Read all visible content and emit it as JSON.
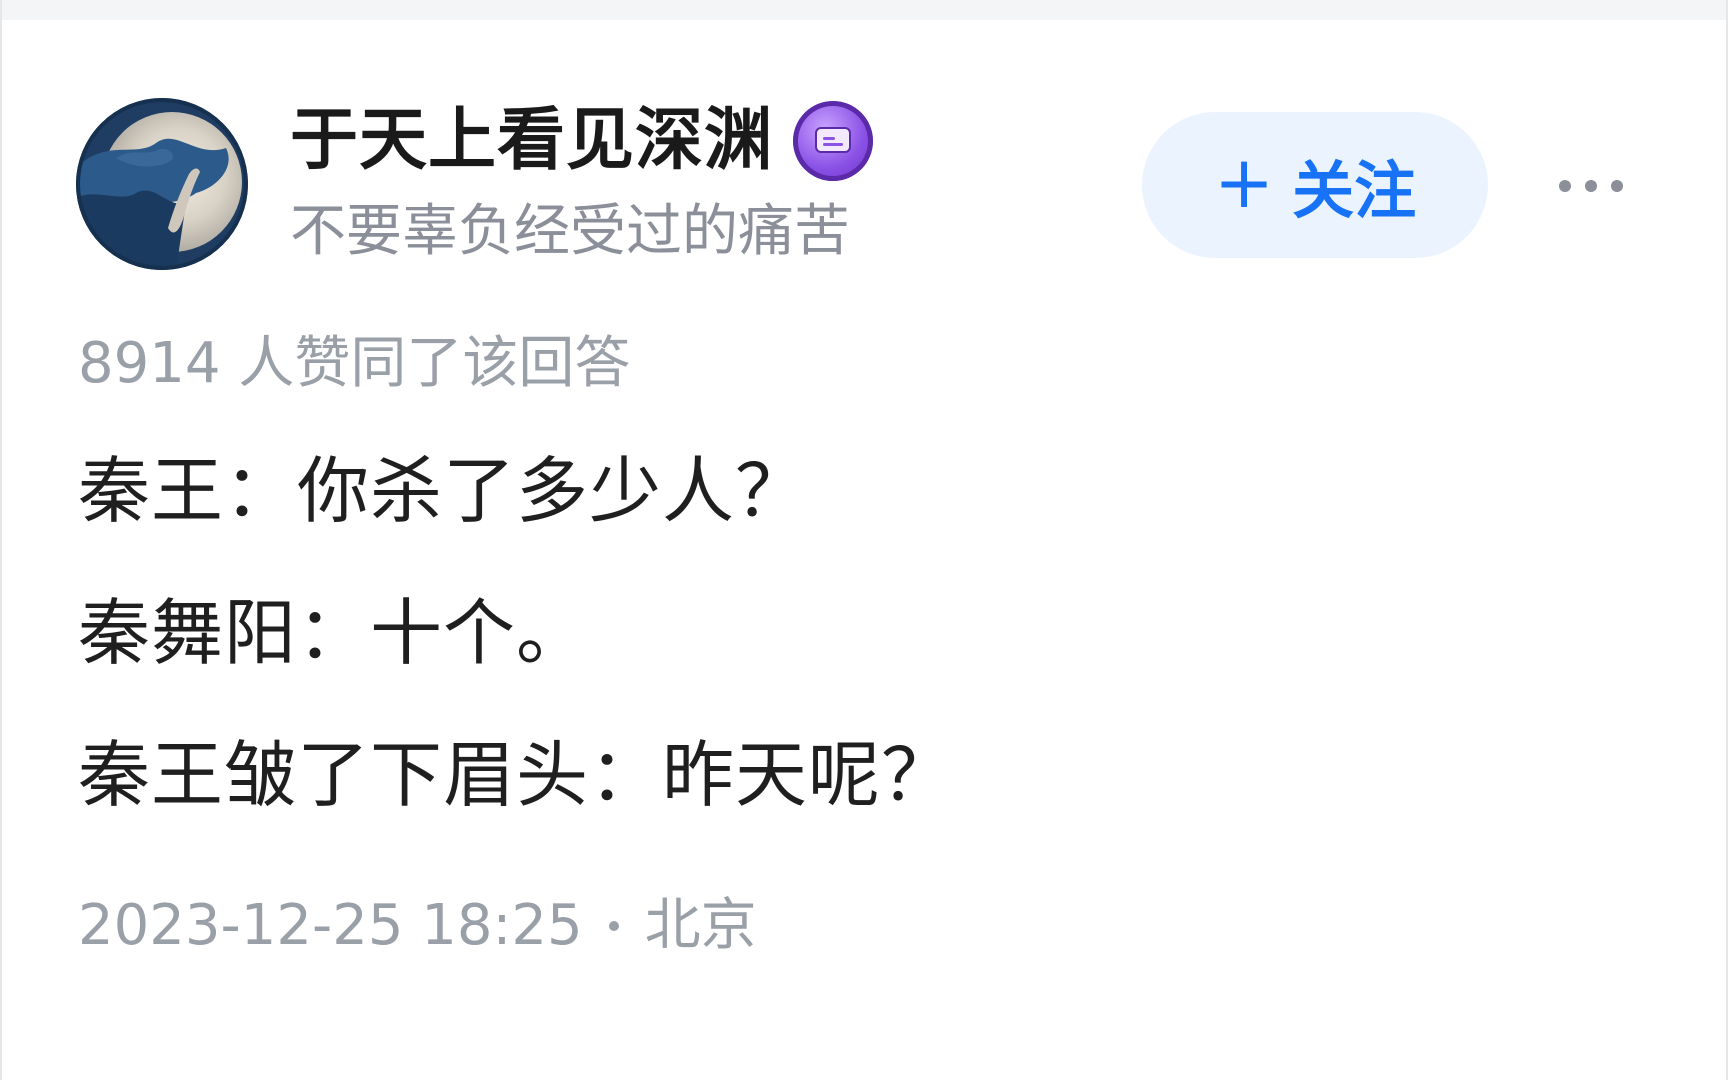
{
  "author": {
    "name": "于天上看见深渊",
    "bio": "不要辜负经受过的痛苦",
    "avatar_icon": "avatar-image",
    "badge_icon": "purple-badge-icon"
  },
  "actions": {
    "follow_label": "关注",
    "follow_icon": "plus-icon",
    "more_icon": "more-dots-icon"
  },
  "answer": {
    "vote_text": "8914 人赞同了该回答",
    "lines": [
      "秦王：你杀了多少人？",
      "秦舞阳：十个。",
      "秦王皱了下眉头：昨天呢？"
    ],
    "timestamp": "2023-12-25 18:25",
    "location": "北京"
  },
  "colors": {
    "accent": "#1772f6",
    "follow_bg": "#ebf3ff",
    "muted_text": "#9aa0a8",
    "badge": "#8b52e6"
  }
}
